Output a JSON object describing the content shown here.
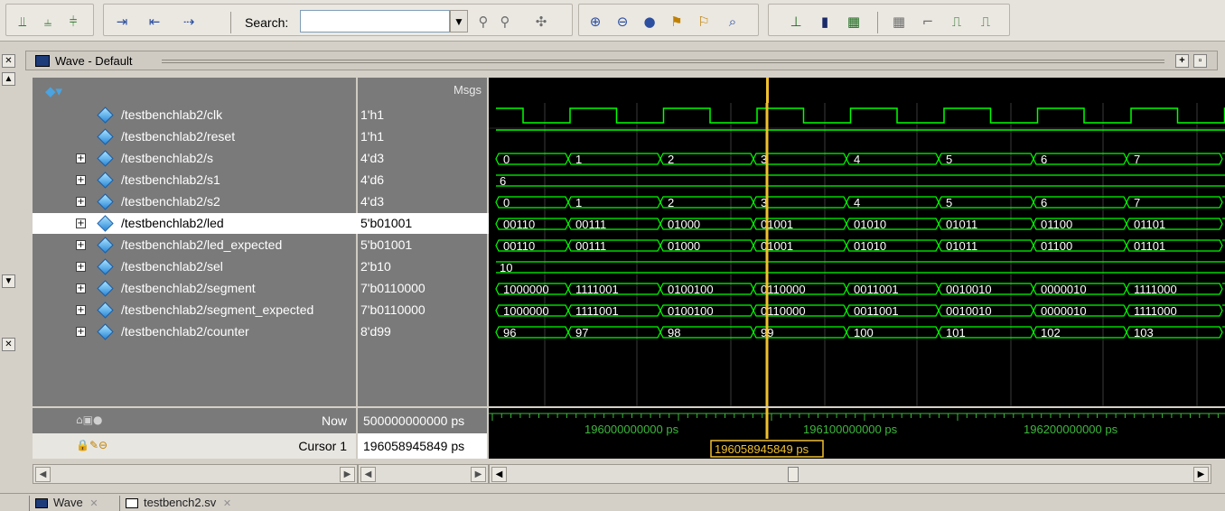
{
  "toolbar": {
    "search_label": "Search:",
    "search_value": "",
    "icons_group1": [
      "wave-insert-icon",
      "wave-insert-2-icon",
      "wave-insert-3-icon"
    ],
    "icons_group2": [
      "step-into-icon",
      "step-over-icon",
      "step-out-icon"
    ],
    "icons_group3": [
      "find-icon",
      "find-next-icon",
      "find-prev-icon"
    ],
    "icons_group4": [
      "zoom-in-icon",
      "zoom-out-icon",
      "zoom-full-icon",
      "zoom-cursor-icon",
      "zoom-range-icon",
      "zoom-last-icon"
    ],
    "icons_group5": [
      "wave-style-1-icon",
      "wave-style-2-icon",
      "wave-style-3-icon",
      "wave-style-4-icon",
      "wave-style-5-icon",
      "wave-style-6-icon",
      "wave-style-7-icon"
    ]
  },
  "window": {
    "title": "Wave - Default"
  },
  "header": {
    "msgs": "Msgs"
  },
  "signals": [
    {
      "name": "/testbenchlab2/clk",
      "value": "1'h1",
      "expandable": false,
      "selected": false
    },
    {
      "name": "/testbenchlab2/reset",
      "value": "1'h1",
      "expandable": false,
      "selected": false
    },
    {
      "name": "/testbenchlab2/s",
      "value": "4'd3",
      "expandable": true,
      "selected": false
    },
    {
      "name": "/testbenchlab2/s1",
      "value": "4'd6",
      "expandable": true,
      "selected": false
    },
    {
      "name": "/testbenchlab2/s2",
      "value": "4'd3",
      "expandable": true,
      "selected": false
    },
    {
      "name": "/testbenchlab2/led",
      "value": "5'b01001",
      "expandable": true,
      "selected": true
    },
    {
      "name": "/testbenchlab2/led_expected",
      "value": "5'b01001",
      "expandable": true,
      "selected": false
    },
    {
      "name": "/testbenchlab2/sel",
      "value": "2'b10",
      "expandable": true,
      "selected": false
    },
    {
      "name": "/testbenchlab2/segment",
      "value": "7'b0110000",
      "expandable": true,
      "selected": false
    },
    {
      "name": "/testbenchlab2/segment_expected",
      "value": "7'b0110000",
      "expandable": true,
      "selected": false
    },
    {
      "name": "/testbenchlab2/counter",
      "value": "8'd99",
      "expandable": true,
      "selected": false
    }
  ],
  "waves": {
    "bus_values": {
      "s": [
        "0",
        "1",
        "2",
        "3",
        "4",
        "5",
        "6",
        "7"
      ],
      "s1": [
        "6"
      ],
      "s2": [
        "0",
        "1",
        "2",
        "3",
        "4",
        "5",
        "6",
        "7"
      ],
      "led": [
        "00110",
        "00111",
        "01000",
        "01001",
        "01010",
        "01011",
        "01100",
        "01101"
      ],
      "led_expected": [
        "00110",
        "00111",
        "01000",
        "01001",
        "01010",
        "01011",
        "01100",
        "01101"
      ],
      "sel": [
        "10"
      ],
      "segment": [
        "1000000",
        "1111001",
        "0100100",
        "0110000",
        "0011001",
        "0010010",
        "0000010",
        "1111000"
      ],
      "segment_expected": [
        "1000000",
        "1111001",
        "0100100",
        "0110000",
        "0011001",
        "0010010",
        "0000010",
        "1111000"
      ],
      "counter": [
        "96",
        "97",
        "98",
        "99",
        "100",
        "101",
        "102",
        "103"
      ]
    },
    "wave_color": "#00ff00",
    "cursor_color": "#f0c030"
  },
  "status": {
    "now_label": "Now",
    "now_value": "500000000000 ps",
    "cursor_label": "Cursor 1",
    "cursor_value": "196058945849 ps",
    "cursor_flag": "196058945849 ps",
    "time_labels": [
      "196000000000 ps",
      "196100000000 ps",
      "196200000000 ps"
    ]
  },
  "tabs": [
    {
      "label": "Wave"
    },
    {
      "label": "testbench2.sv"
    }
  ]
}
